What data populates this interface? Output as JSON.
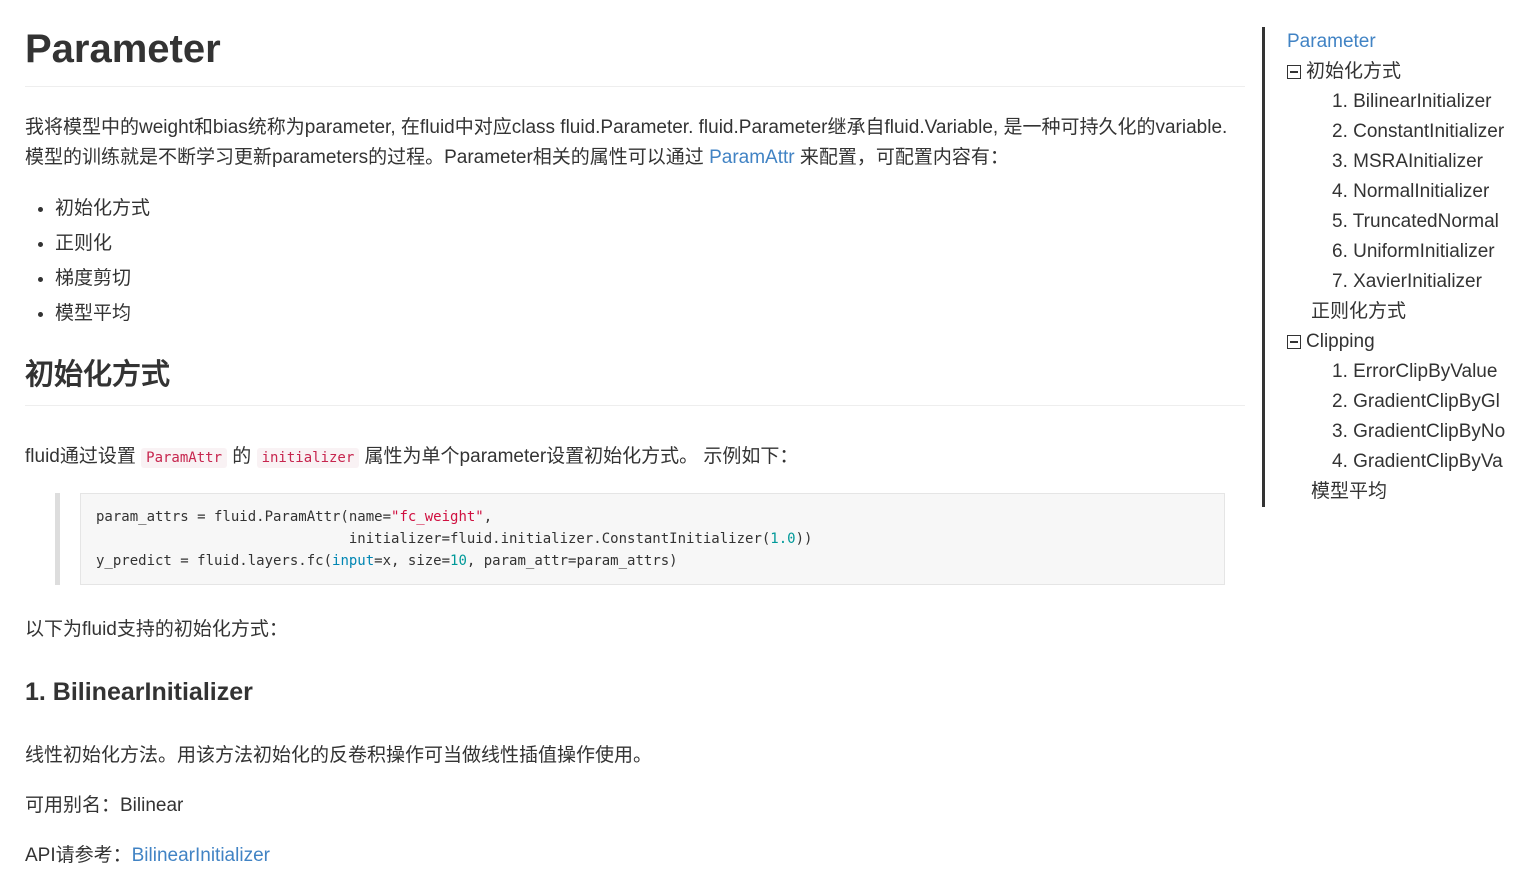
{
  "main": {
    "title": "Parameter",
    "intro_part1": "我将模型中的weight和bias统称为parameter, 在fluid中对应class fluid.Parameter. fluid.Parameter继承自fluid.Variable, 是一种可持久化的variable. 模型的训练就是不断学习更新parameters的过程。Parameter相关的属性可以通过 ",
    "intro_link": "ParamAttr",
    "intro_part2": " 来配置，可配置内容有：",
    "bullets": [
      "初始化方式",
      "正则化",
      "梯度剪切",
      "模型平均"
    ],
    "section_init": {
      "heading": "初始化方式",
      "line_part1": "fluid通过设置 ",
      "code1": "ParamAttr",
      "line_part2": " 的 ",
      "code2": "initializer",
      "line_part3": " 属性为单个parameter设置初始化方式。 示例如下：",
      "code_block": {
        "l1_a": "param_attrs = fluid.ParamAttr(name=",
        "l1_str": "\"fc_weight\"",
        "l1_b": ",",
        "l2_a": "                              initializer=fluid.initializer.ConstantInitializer(",
        "l2_num": "1.0",
        "l2_b": "))",
        "l3_a": "y_predict = fluid.layers.fc(",
        "l3_kw": "input",
        "l3_b": "=x, size=",
        "l3_num": "10",
        "l3_c": ", param_attr=param_attrs)"
      },
      "supported_text": "以下为fluid支持的初始化方式：",
      "sub1": {
        "heading": "1. BilinearInitializer",
        "desc": "线性初始化方法。用该方法初始化的反卷积操作可当做线性插值操作使用。",
        "alias": "可用别名：Bilinear",
        "api_label": "API请参考：",
        "api_link": "BilinearInitializer"
      }
    }
  },
  "toc": {
    "top": "Parameter",
    "items": [
      {
        "label": "初始化方式",
        "children": [
          "1. BilinearInitializer",
          "2. ConstantInitializer",
          "3. MSRAInitializer",
          "4. NormalInitializer",
          "5. TruncatedNormal",
          "6. UniformInitializer",
          "7. XavierInitializer"
        ]
      },
      {
        "label": "正则化方式"
      },
      {
        "label": "Clipping",
        "children": [
          "1. ErrorClipByValue",
          "2. GradientClipByGl",
          "3. GradientClipByNo",
          "4. GradientClipByVa"
        ]
      },
      {
        "label": "模型平均"
      }
    ]
  }
}
